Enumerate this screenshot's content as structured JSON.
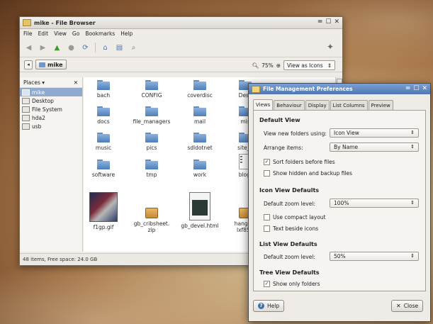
{
  "browser": {
    "title": "mike - File Browser",
    "menu": [
      "File",
      "Edit",
      "View",
      "Go",
      "Bookmarks",
      "Help"
    ],
    "location": "mike",
    "zoom": "75%",
    "view_mode": "View as Icons",
    "places_label": "Places",
    "places": [
      "mike",
      "Desktop",
      "File System",
      "hda2",
      "usb"
    ],
    "items": [
      {
        "name": "bach",
        "kind": "folder"
      },
      {
        "name": "CONFIG",
        "kind": "folder"
      },
      {
        "name": "coverdisc",
        "kind": "folder"
      },
      {
        "name": "Desk",
        "kind": "folder"
      },
      {
        "name": "docs",
        "kind": "folder"
      },
      {
        "name": "file_managers",
        "kind": "folder"
      },
      {
        "name": "mail",
        "kind": "folder"
      },
      {
        "name": "mis",
        "kind": "folder"
      },
      {
        "name": "music",
        "kind": "folder"
      },
      {
        "name": "pics",
        "kind": "folder"
      },
      {
        "name": "sdldotnet",
        "kind": "folder"
      },
      {
        "name": "site_v",
        "kind": "folder"
      },
      {
        "name": "software",
        "kind": "folder"
      },
      {
        "name": "tmp",
        "kind": "folder"
      },
      {
        "name": "work",
        "kind": "folder"
      },
      {
        "name": "blog.",
        "kind": "document"
      },
      {
        "name": "f1gp.gif",
        "kind": "image"
      },
      {
        "name": "gb_cribsheet.\nzip",
        "kind": "archive"
      },
      {
        "name": "gb_devel.html",
        "kind": "html"
      },
      {
        "name": "hanging\nlxf85.t",
        "kind": "archive"
      }
    ],
    "status": "48 items, Free space: 24.0 GB"
  },
  "prefs": {
    "title": "File Management Preferences",
    "tabs": [
      "Views",
      "Behaviour",
      "Display",
      "List Columns",
      "Preview"
    ],
    "active_tab": "Views",
    "default_view": {
      "heading": "Default View",
      "new_folders_label": "View new folders using:",
      "new_folders_value": "Icon View",
      "arrange_label": "Arrange items:",
      "arrange_value": "By Name",
      "sort_folders_label": "Sort folders before files",
      "sort_folders_checked": true,
      "show_hidden_label": "Show hidden and backup files",
      "show_hidden_checked": false
    },
    "icon_view": {
      "heading": "Icon View Defaults",
      "zoom_label": "Default zoom level:",
      "zoom_value": "100%",
      "compact_label": "Use compact layout",
      "compact_checked": false,
      "text_beside_label": "Text beside icons",
      "text_beside_checked": false
    },
    "list_view": {
      "heading": "List View Defaults",
      "zoom_label": "Default zoom level:",
      "zoom_value": "50%"
    },
    "tree_view": {
      "heading": "Tree View Defaults",
      "only_folders_label": "Show only folders",
      "only_folders_checked": true
    },
    "help_button": "Help",
    "close_button": "Close"
  }
}
